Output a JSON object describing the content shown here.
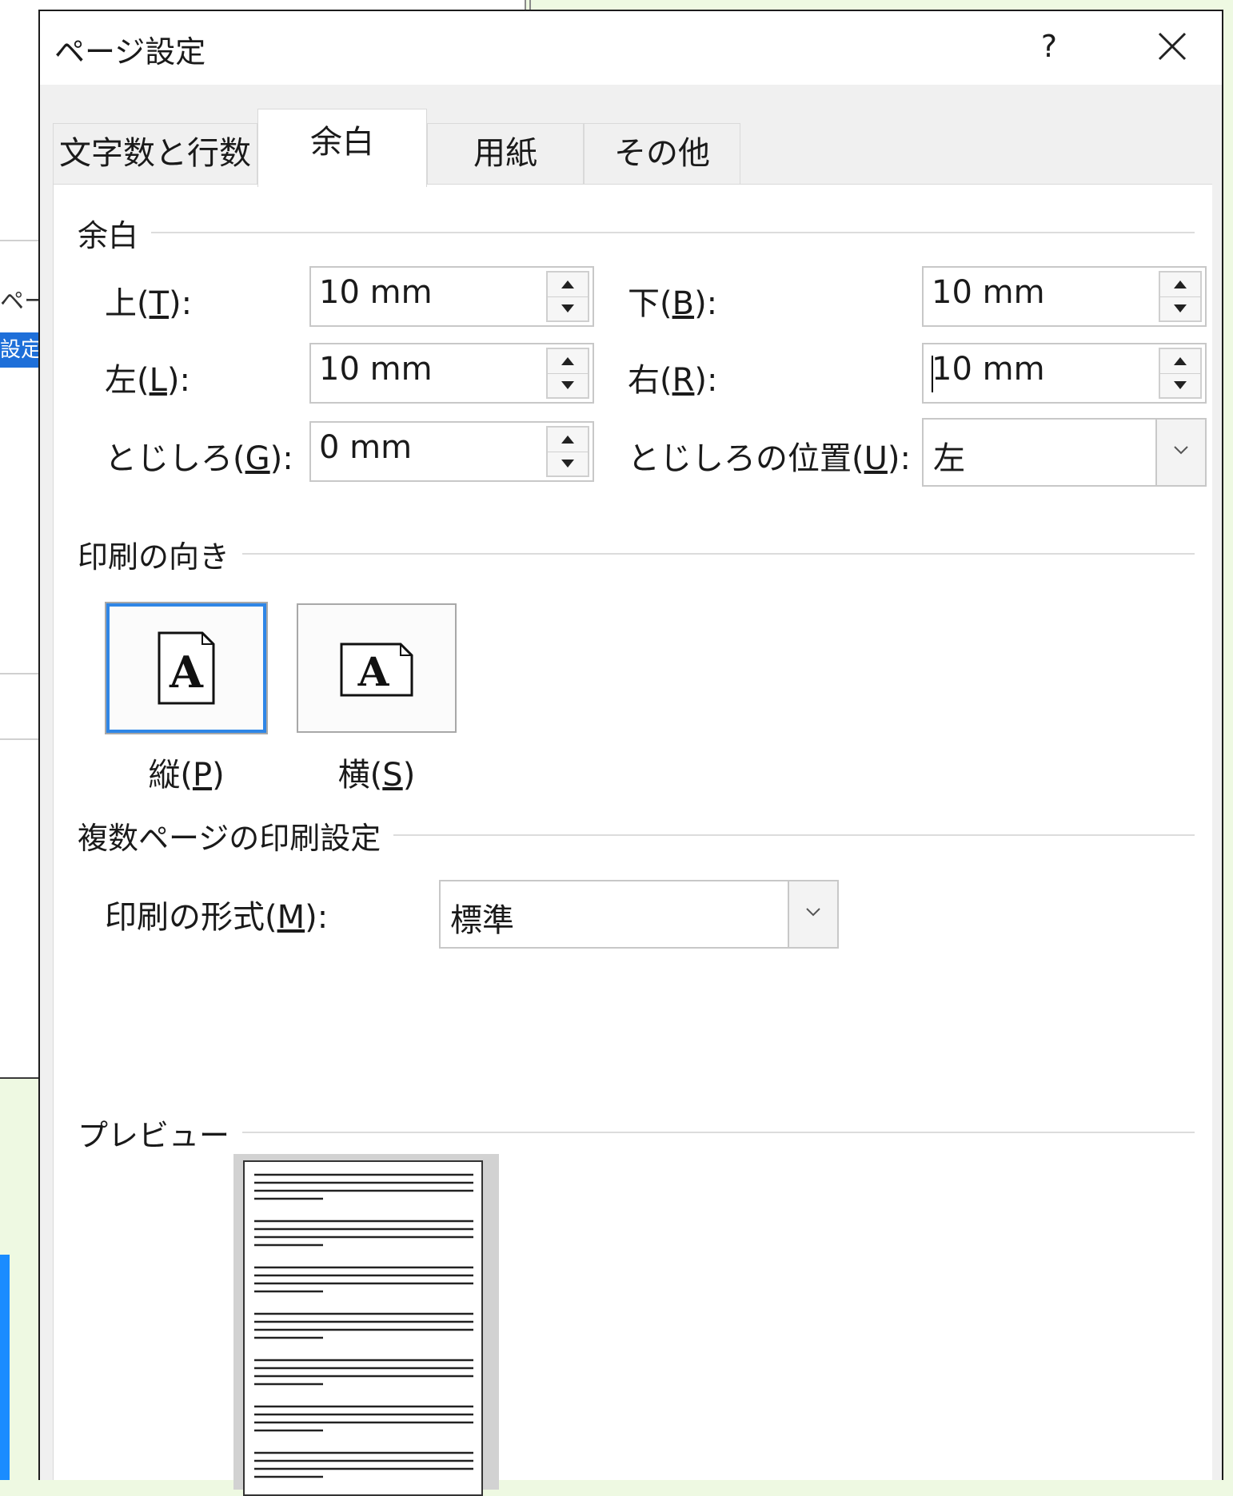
{
  "background": {
    "partial_text_1": "ペー",
    "partial_text_2": "設定"
  },
  "dialog": {
    "title": "ページ設定",
    "help_label": "?",
    "tabs": [
      {
        "label": "文字数と行数",
        "active": false
      },
      {
        "label": "余白",
        "active": true
      },
      {
        "label": "用紙",
        "active": false
      },
      {
        "label": "その他",
        "active": false
      }
    ]
  },
  "margins": {
    "heading": "余白",
    "top": {
      "label": "上(",
      "key": "T",
      "suffix": "):",
      "value": "10 mm"
    },
    "bottom": {
      "label": "下(",
      "key": "B",
      "suffix": "):",
      "value": "10 mm"
    },
    "left": {
      "label": "左(",
      "key": "L",
      "suffix": "):",
      "value": "10 mm"
    },
    "right": {
      "label": "右(",
      "key": "R",
      "suffix": "):",
      "value": "10 mm"
    },
    "gutter": {
      "label": "とじしろ(",
      "key": "G",
      "suffix": "):",
      "value": "0 mm"
    },
    "gutter_position": {
      "label": "とじしろの位置(",
      "key": "U",
      "suffix": "):",
      "value": "左"
    }
  },
  "orientation": {
    "heading": "印刷の向き",
    "portrait": {
      "label": "縦(",
      "key": "P",
      "suffix": ")",
      "selected": true
    },
    "landscape": {
      "label": "横(",
      "key": "S",
      "suffix": ")",
      "selected": false
    },
    "icon_glyph": "A"
  },
  "multiple_pages": {
    "heading": "複数ページの印刷設定",
    "format_label": "印刷の形式(",
    "format_key": "M",
    "format_suffix": "):",
    "format_value": "標準"
  },
  "preview": {
    "heading": "プレビュー"
  },
  "colors": {
    "selection_border": "#2f86e6",
    "page_background": "#eef9e2",
    "background_highlight": "#1e6fd9"
  }
}
